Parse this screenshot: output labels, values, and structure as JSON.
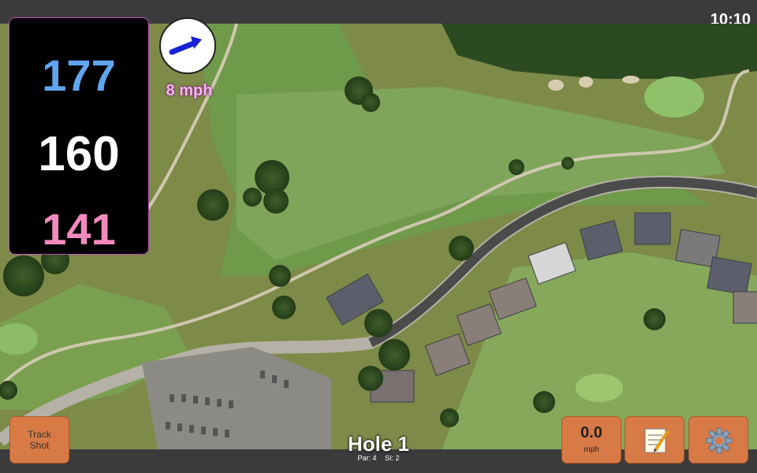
{
  "status": {
    "time": "10:10"
  },
  "distances": {
    "back": "177",
    "middle": "160",
    "front": "141"
  },
  "wind": {
    "speed_label": "8 mph",
    "direction_icon": "wind-arrow-icon"
  },
  "buttons": {
    "track_shot_line1": "Track",
    "track_shot_line2": "Shot",
    "speed_value": "0.0",
    "speed_unit": "mph",
    "notes_icon": "notepad-icon",
    "settings_icon": "gear-icon"
  },
  "hole": {
    "title": "Hole 1",
    "par": "Par: 4",
    "si": "SI: 2"
  },
  "colors": {
    "back": "#5fa6ee",
    "middle": "#ffffff",
    "front": "#f28ac0",
    "button": "#d87a45",
    "wind_text": "#f4b8ee"
  }
}
